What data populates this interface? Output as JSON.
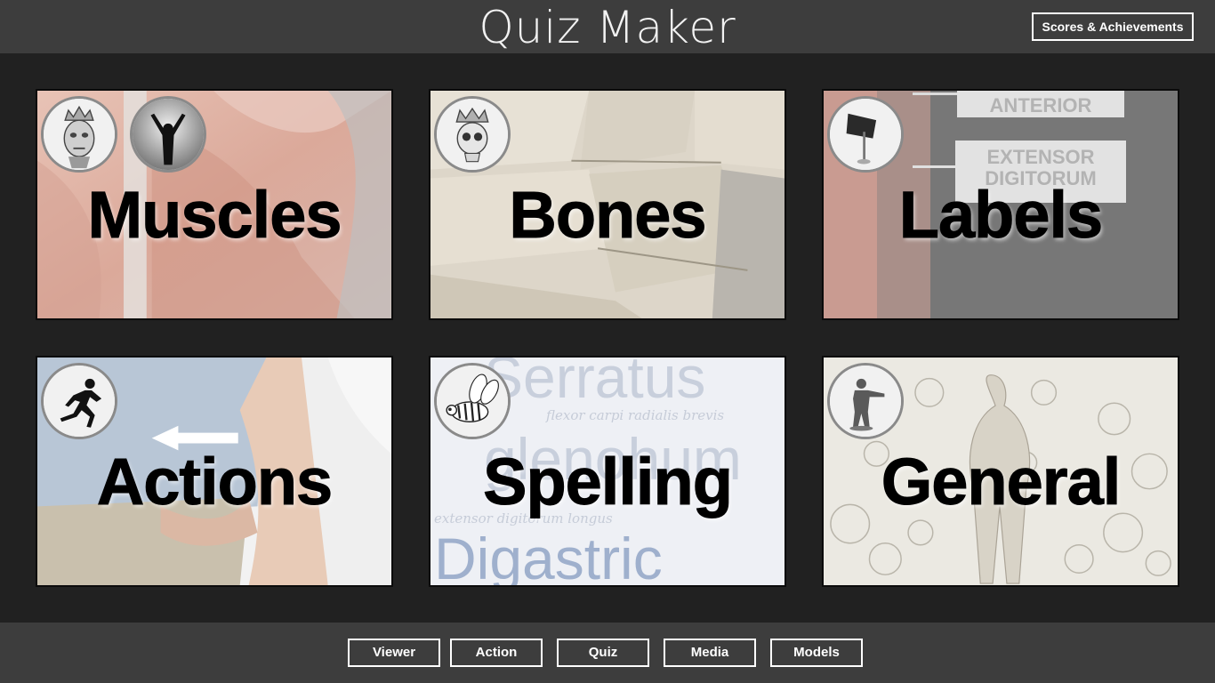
{
  "header": {
    "title": "Quiz Maker",
    "scores_button": "Scores & Achievements"
  },
  "tiles": [
    {
      "label": "Muscles",
      "icons": [
        "skull-king-icon",
        "raised-arms-figure-icon"
      ]
    },
    {
      "label": "Bones",
      "icons": [
        "crowned-skull-icon"
      ]
    },
    {
      "label": "Labels",
      "icons": [
        "flag-icon"
      ]
    },
    {
      "label": "Actions",
      "icons": [
        "sprinter-icon"
      ]
    },
    {
      "label": "Spelling",
      "icons": [
        "spelling-bee-icon"
      ]
    },
    {
      "label": "General",
      "icons": [
        "toy-soldier-icon"
      ]
    }
  ],
  "tile_backgrounds": {
    "labels": [
      "ANTERIOR",
      "EXTENSOR",
      "DIGITORUM"
    ],
    "spelling": [
      "Serratus",
      "flexor carpi radialis brevis",
      "glenohum",
      "extensor digitorum longus",
      "Digastric"
    ]
  },
  "bottom_nav": [
    "Viewer",
    "Action",
    "Quiz",
    "Media",
    "Models"
  ]
}
